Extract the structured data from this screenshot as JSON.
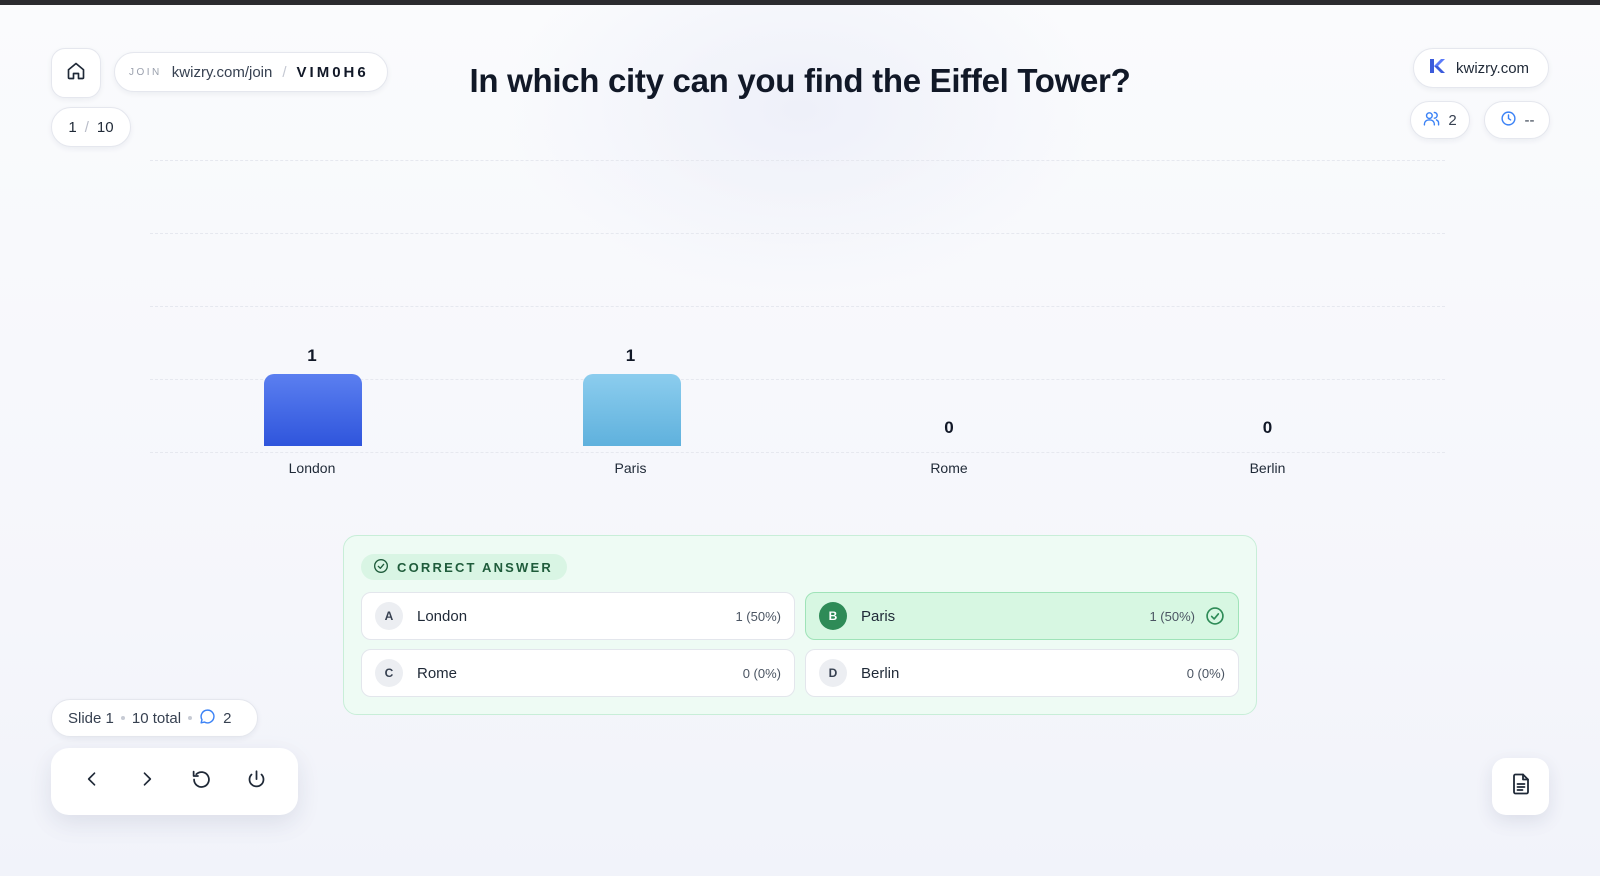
{
  "join": {
    "label": "JOIN",
    "url": "kwizry.com/join",
    "separator": "/",
    "code": "VIM0H6"
  },
  "counter": {
    "current": "1",
    "separator": "/",
    "total": "10"
  },
  "question": "In which city can you find the Eiffel Tower?",
  "brand": {
    "name": "kwizry.com",
    "color": "#3b5bdb"
  },
  "stats": {
    "players": "2",
    "timer": "--"
  },
  "chart_data": {
    "type": "bar",
    "categories": [
      "London",
      "Paris",
      "Rome",
      "Berlin"
    ],
    "values": [
      1,
      1,
      0,
      0
    ],
    "colors": [
      "#3d62e0",
      "#79c3e9",
      "#cccccc",
      "#cccccc"
    ],
    "title": "",
    "xlabel": "",
    "ylabel": "",
    "grid": true
  },
  "answers": {
    "badge": "CORRECT ANSWER",
    "options": [
      {
        "letter": "A",
        "text": "London",
        "count": "1 (50%)",
        "correct": false
      },
      {
        "letter": "B",
        "text": "Paris",
        "count": "1 (50%)",
        "correct": true
      },
      {
        "letter": "C",
        "text": "Rome",
        "count": "0 (0%)",
        "correct": false
      },
      {
        "letter": "D",
        "text": "Berlin",
        "count": "0 (0%)",
        "correct": false
      }
    ]
  },
  "slide_info": {
    "slide": "Slide 1",
    "total": "10 total",
    "comments": "2"
  },
  "icons": {
    "home": "home-icon",
    "brand": "kwizry-logo-icon",
    "players": "users-icon",
    "timer": "clock-icon",
    "prev": "chevron-left-icon",
    "next": "chevron-right-icon",
    "reset": "rotate-ccw-icon",
    "power": "power-icon",
    "doc": "document-icon",
    "comment": "comment-icon",
    "check": "check-circle-icon"
  },
  "colors": {
    "correct": "#2e8b57",
    "accent": "#3b82f6"
  }
}
